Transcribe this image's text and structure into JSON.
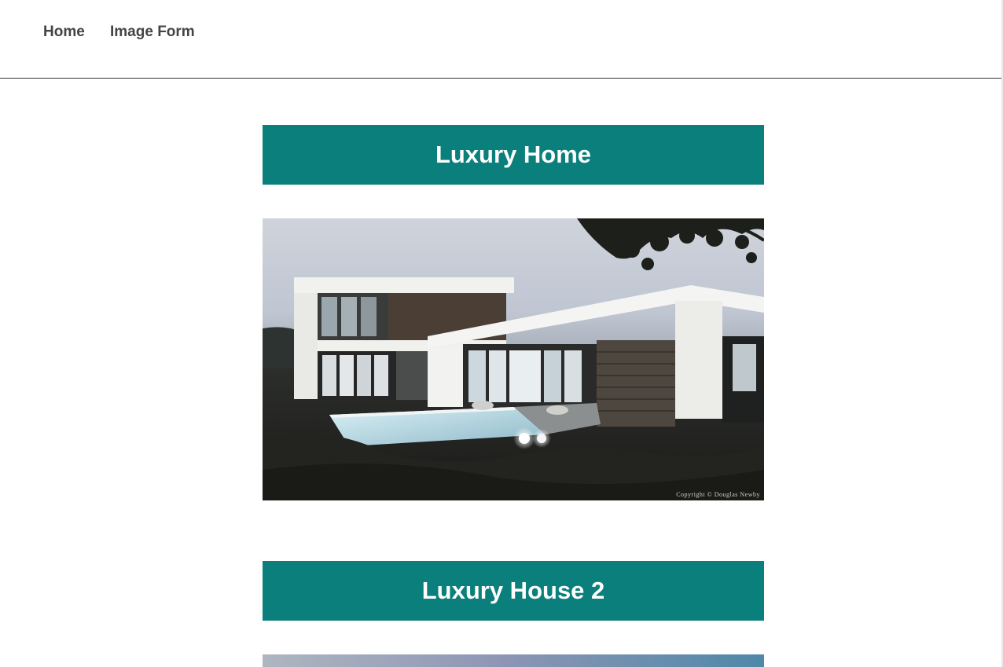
{
  "nav": {
    "links": [
      {
        "label": "Home"
      },
      {
        "label": "Image Form"
      }
    ]
  },
  "listings": [
    {
      "title": "Luxury Home",
      "photo": {
        "copyright": "Copyright © Douglas Newby"
      }
    },
    {
      "title": "Luxury House 2"
    }
  ],
  "colors": {
    "title_bar": "#0a7f7c",
    "title_text": "#ffffff",
    "nav_text": "#444444",
    "divider": "#333333"
  }
}
